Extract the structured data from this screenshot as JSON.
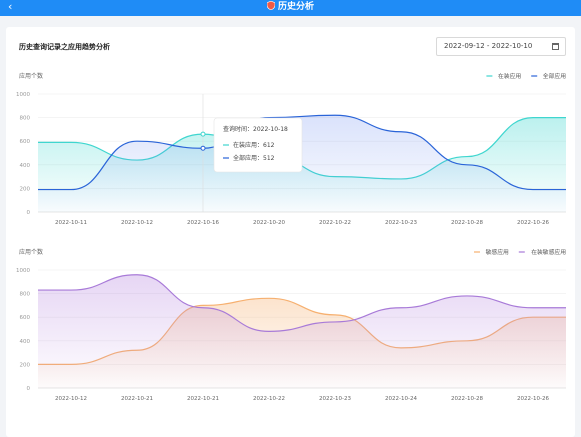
{
  "header": {
    "title": "历史分析",
    "back_icon": "chevron-left-icon",
    "logo_icon": "shield-icon"
  },
  "page": {
    "heading": "历史查询记录之应用趋势分析",
    "date_range": "2022-09-12 - 2022-10-10"
  },
  "chart_data": [
    {
      "type": "area",
      "ylabel": "应用个数",
      "ylim": [
        0,
        1000
      ],
      "yticks": [
        0,
        200,
        400,
        600,
        800,
        1000
      ],
      "categories": [
        "2022-10-11",
        "2022-10-12",
        "2022-10-16",
        "2022-10-20",
        "2022-10-22",
        "2022-10-23",
        "2022-10-28",
        "2022-10-26"
      ],
      "legend_position": "top-right",
      "series": [
        {
          "name": "在装应用",
          "color": "#3fd6cf",
          "values": [
            590,
            440,
            660,
            480,
            300,
            280,
            470,
            800
          ]
        },
        {
          "name": "全部应用",
          "color": "#2a64d8",
          "values": [
            190,
            600,
            540,
            800,
            820,
            680,
            400,
            190
          ]
        }
      ],
      "tooltip": {
        "title": "查询时间：2022-10-18",
        "rows": [
          {
            "label": "在装应用：",
            "value": "612"
          },
          {
            "label": "全部应用：",
            "value": "512"
          }
        ]
      }
    },
    {
      "type": "area",
      "ylabel": "应用个数",
      "ylim": [
        0,
        1000
      ],
      "yticks": [
        0,
        200,
        400,
        600,
        800,
        1000
      ],
      "categories": [
        "2022-10-12",
        "2022-10-21",
        "2022-10-21",
        "2022-10-22",
        "2022-10-23",
        "2022-10-24",
        "2022-10-28",
        "2022-10-26"
      ],
      "legend_position": "top-right",
      "series": [
        {
          "name": "敏感应用",
          "color": "#f6b070",
          "values": [
            200,
            320,
            700,
            760,
            620,
            340,
            400,
            600
          ]
        },
        {
          "name": "在装敏感应用",
          "color": "#a87ad8",
          "values": [
            830,
            960,
            680,
            480,
            560,
            680,
            780,
            680
          ]
        }
      ]
    }
  ]
}
